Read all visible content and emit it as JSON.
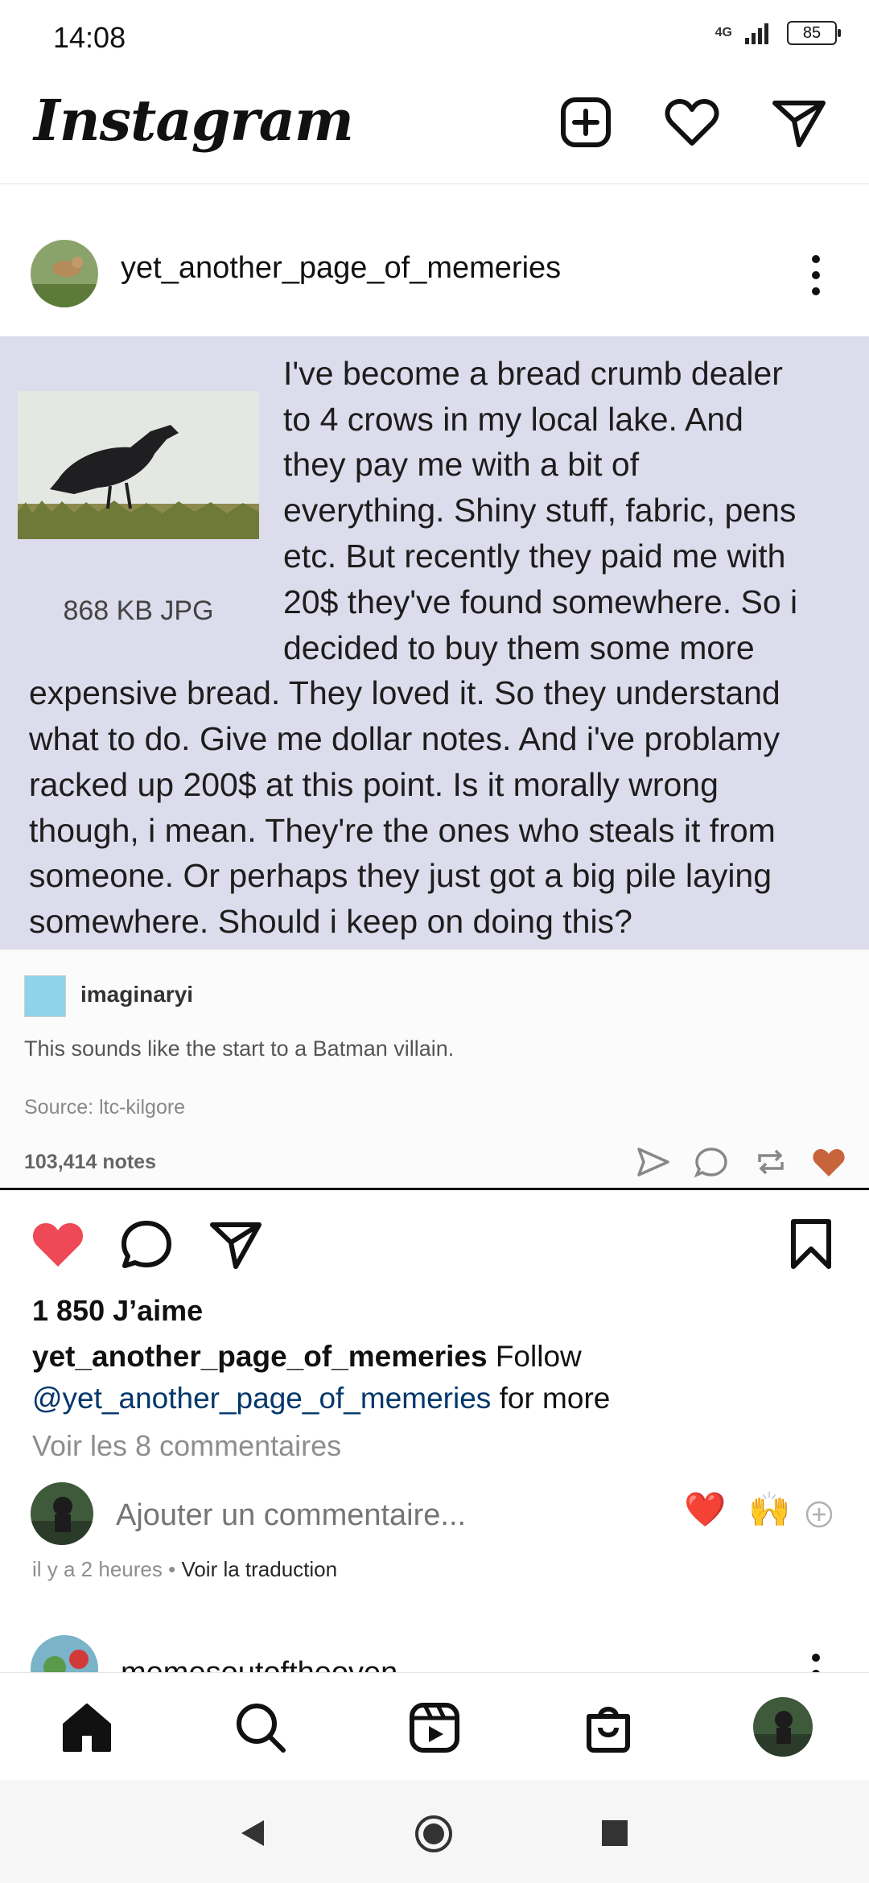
{
  "status": {
    "time": "14:08",
    "network": "4G",
    "battery": "85"
  },
  "app": {
    "name": "Instagram"
  },
  "post": {
    "username": "yet_another_page_of_memeries",
    "meme": {
      "file_info": "868 KB JPG",
      "lines": [
        "I've become a bread crumb dealer",
        "to 4 crows in my local lake. And",
        "they pay me with a bit of",
        "everything. Shiny stuff, fabric, pens",
        "etc. But recently they paid me with",
        "20$ they've found somewhere. So i",
        "decided to buy them some more",
        "expensive bread. They loved it. So they understand",
        "what to do. Give me dollar notes. And i've problamy",
        "racked up 200$ at this point. Is it morally wrong",
        "though, i mean. They're the ones who steals it from",
        "someone. Or perhaps they just got a big pile laying",
        "somewhere. Should i keep on doing this?"
      ],
      "reply_user": "imaginaryi",
      "reply_text": "This sounds like the start to a Batman villain.",
      "source": "Source:  ltc-kilgore",
      "notes": "103,414 notes"
    },
    "likes": "1 850 J’aime",
    "caption_user": "yet_another_page_of_memeries",
    "caption_text": " Follow",
    "caption_mention": "@yet_another_page_of_memeries",
    "caption_tail": " for more",
    "view_comments": "Voir les 8 commentaires",
    "add_comment_placeholder": "Ajouter un commentaire...",
    "quick_reactions": [
      "❤️",
      "🙌"
    ],
    "time_ago": "il y a 2 heures",
    "meta_sep": " • ",
    "see_translation": "Voir la traduction"
  },
  "next_post": {
    "username": "memesoutoftheoven"
  },
  "colors": {
    "like": "#ed4956",
    "meme_bg": "#dcdced",
    "link": "#00376b"
  }
}
